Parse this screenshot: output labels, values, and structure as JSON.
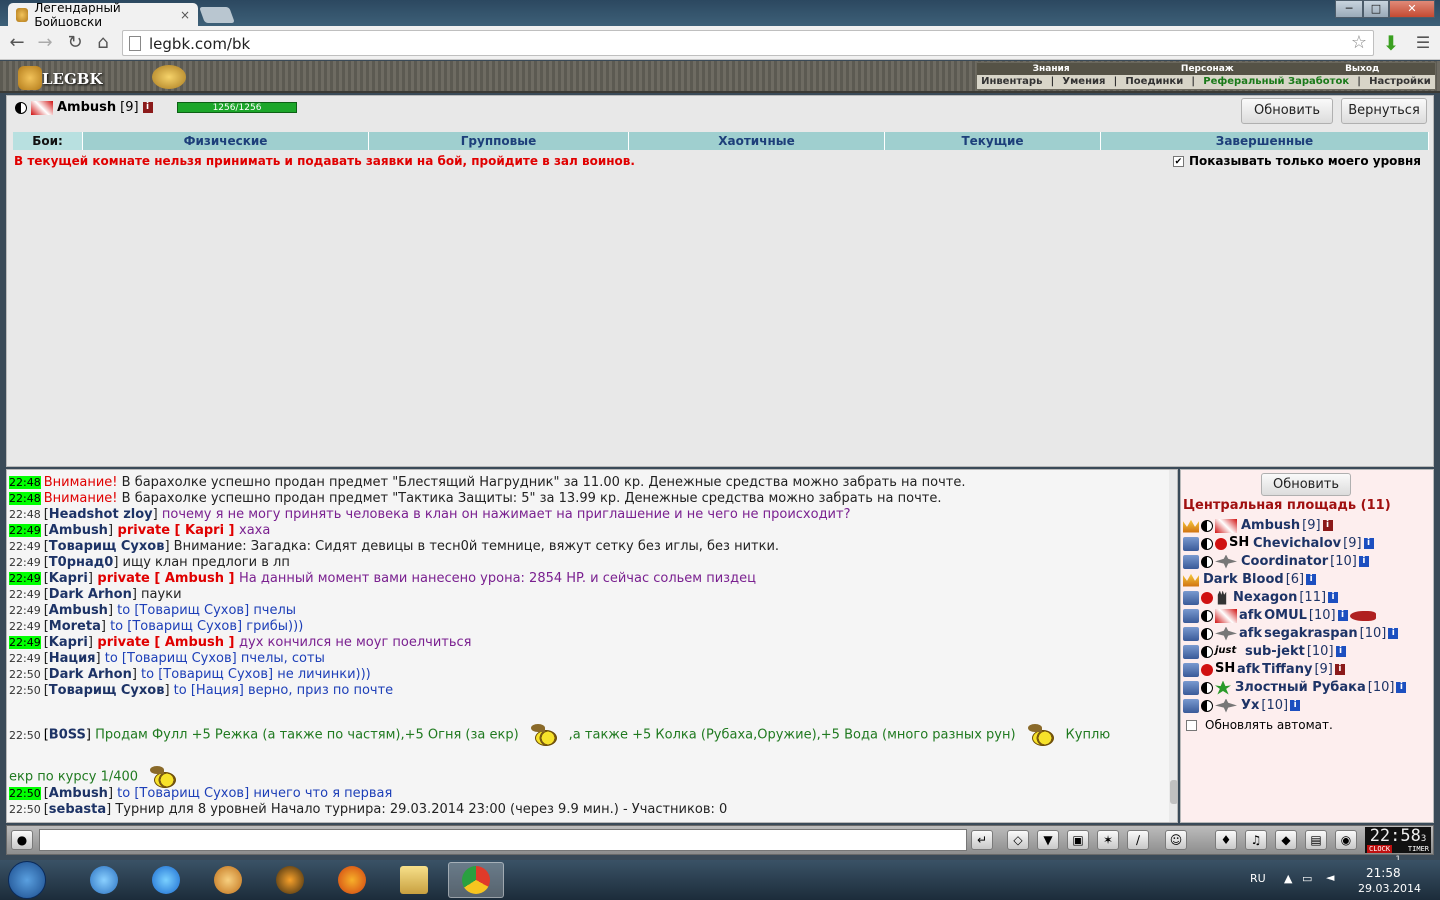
{
  "browser": {
    "tab_title": "Легендарный Бойцовски",
    "tab_close": "×",
    "window_min": "─",
    "window_max": "□",
    "window_close": "✕",
    "url": "legbk.com/bk"
  },
  "game_header": {
    "logo": "LEGBK",
    "nav_top": [
      "Знания",
      "Персонаж",
      "Выход"
    ],
    "nav_bottom": [
      "Инвентарь",
      "Умения",
      "Поединки",
      "Реферальный Заработок",
      "Настройки"
    ]
  },
  "player": {
    "name": "Ambush",
    "level": "[9]",
    "hp": "1256/1256",
    "hp_fraction": 1.0
  },
  "buttons": {
    "refresh": "Обновить",
    "back": "Вернуться",
    "users_refresh": "Обновить"
  },
  "fight_tabs": {
    "label": "Бои:",
    "items": [
      "Физические",
      "Групповые",
      "Хаотичные",
      "Текущие",
      "Завершенные"
    ]
  },
  "warning": "В текущей комнате нельзя принимать и подавать заявки на бой, пройдите в зал воинов.",
  "show_my_level": "Показывать только моего уровня",
  "chat": {
    "messages": [
      {
        "time": "22:48",
        "hl": true,
        "prefix": "Внимание!",
        "text": " В барахолке успешно продан предмет \"Блестящий Нагрудник\" за 11.00 кр. Денежные средства можно забрать на почте."
      },
      {
        "time": "22:48",
        "hl": true,
        "prefix": "Внимание!",
        "text": " В барахолке успешно продан предмет \"Тактика Защиты: 5\" за 13.99 кр. Денежные средства можно забрать на почте."
      },
      {
        "time": "22:48",
        "nick": "Headshot zloy",
        "text": " почему я не могу принять человека в клан он нажимает на приглашение и не чего не происходит?"
      },
      {
        "time": "22:49",
        "hl": true,
        "nick": "Ambush",
        "priv": " private [ Kapri ] ",
        "text": "хаха"
      },
      {
        "time": "22:49",
        "nick": "Товарищ Сухов",
        "text": " Внимание: Загадка: Сидят девицы в тесн0й темнице, вяжут сетку без иглы, без нитки."
      },
      {
        "time": "22:49",
        "nick": "T0рнад0",
        "text": " ищу клан предлоги в лп"
      },
      {
        "time": "22:49",
        "hl": true,
        "nick": "Kapri",
        "priv": " private [ Ambush ] ",
        "text": "На данный момент вами нанесено урона: 2854 HP. и сейчас сольем пиздец"
      },
      {
        "time": "22:49",
        "nick": "Dark Arhon",
        "text": " пауки"
      },
      {
        "time": "22:49",
        "nick": "Ambush",
        "to": " to [Товарищ Сухов] ",
        "text": "пчелы"
      },
      {
        "time": "22:49",
        "nick": "Moreta",
        "to": " to [Товарищ Сухов] ",
        "text": "грибы)))"
      },
      {
        "time": "22:49",
        "hl": true,
        "nick": "Kapri",
        "priv": " private [ Ambush ] ",
        "text": "дух кончился не моуг поелчиться"
      },
      {
        "time": "22:49",
        "nick": "Нация",
        "to": " to [Товарищ Сухов] ",
        "text": "пчелы, соты"
      },
      {
        "time": "22:50",
        "nick": "Dark Arhon",
        "to": " to [Товарищ Сухов] ",
        "text": "не личинки)))"
      },
      {
        "time": "22:50",
        "nick": "Товарищ Сухов",
        "to": " to [Нация] ",
        "text": "верно, приз по почте"
      }
    ],
    "boss_msg": {
      "time": "22:50",
      "nick": "B0SS",
      "part1": " Продам Фулл +5 Режка (а также по частям),+5 Огня (за екр)",
      "part2": ",а также +5 Колка (Рубаха,Оружие),+5 Вода (много разных рун)",
      "part3": "Куплю",
      "part4": "екр по курсу 1/400"
    },
    "tail": [
      {
        "time": "22:50",
        "hl": true,
        "nick": "Ambush",
        "to": " to [Товарищ Сухов] ",
        "text": "ничего что я первая"
      },
      {
        "time": "22:50",
        "nick": "sebasta",
        "text": " Турнир для 8 уровней Начало турнира: 29.03.2014 23:00 (через 9.9 мин.) - Участников: 0"
      }
    ]
  },
  "users": {
    "room": "Центральная площадь (11)",
    "list": [
      {
        "name": "Ambush",
        "level": "[9]",
        "afk": ""
      },
      {
        "name": "Chevichalov",
        "level": "[9]",
        "afk": ""
      },
      {
        "name": "Coordinator",
        "level": "[10]",
        "afk": ""
      },
      {
        "name": "Dark Blood",
        "level": "[6]",
        "afk": ""
      },
      {
        "name": "Nexagon",
        "level": "[11]",
        "afk": ""
      },
      {
        "name": "OMUL",
        "level": "[10]",
        "afk": "afk "
      },
      {
        "name": "segakraspan",
        "level": "[10]",
        "afk": "afk "
      },
      {
        "name": "sub-jekt",
        "level": "[10]",
        "afk": ""
      },
      {
        "name": "Tiffany",
        "level": "[9]",
        "afk": "afk "
      },
      {
        "name": "Злостный Рубака",
        "level": "[10]",
        "afk": ""
      },
      {
        "name": "Ух",
        "level": "[10]",
        "afk": ""
      }
    ],
    "auto_refresh": "Обновлять автомат."
  },
  "clock": {
    "time": "22:58",
    "sec": "3 1",
    "l1": "CLOCK",
    "l2": "TIMER"
  },
  "taskbar": {
    "lang": "RU",
    "time": "21:58",
    "date": "29.03.2014"
  }
}
